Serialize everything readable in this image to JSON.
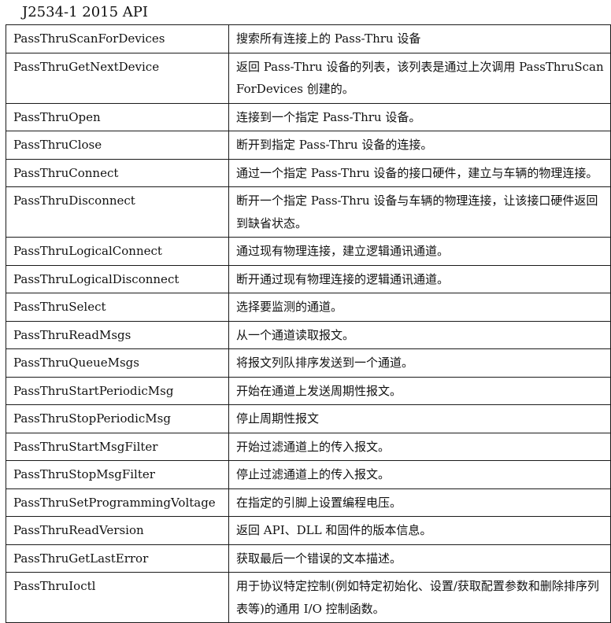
{
  "title": "J2534-1 2015 API",
  "rows": [
    {
      "fn": "PassThruScanForDevices",
      "desc": "搜索所有连接上的 Pass-Thru 设备"
    },
    {
      "fn": "PassThruGetNextDevice",
      "desc": "返回 Pass-Thru 设备的列表，该列表是通过上次调用 PassThruScanForDevices 创建的。"
    },
    {
      "fn": "PassThruOpen",
      "desc": "连接到一个指定 Pass-Thru 设备。"
    },
    {
      "fn": "PassThruClose",
      "desc": "断开到指定 Pass-Thru 设备的连接。"
    },
    {
      "fn": "PassThruConnect",
      "desc": "通过一个指定 Pass-Thru 设备的接口硬件，建立与车辆的物理连接。"
    },
    {
      "fn": "PassThruDisconnect",
      "desc": "断开一个指定 Pass-Thru 设备与车辆的物理连接，让该接口硬件返回到缺省状态。"
    },
    {
      "fn": "PassThruLogicalConnect",
      "desc": "通过现有物理连接，建立逻辑通讯通道。"
    },
    {
      "fn": "PassThruLogicalDisconnect",
      "desc": "断开通过现有物理连接的逻辑通讯通道。"
    },
    {
      "fn": "PassThruSelect",
      "desc": "选择要监测的通道。"
    },
    {
      "fn": "PassThruReadMsgs",
      "desc": "从一个通道读取报文。"
    },
    {
      "fn": "PassThruQueueMsgs",
      "desc": "将报文列队排序发送到一个通道。"
    },
    {
      "fn": "PassThruStartPeriodicMsg",
      "desc": "开始在通道上发送周期性报文。"
    },
    {
      "fn": "PassThruStopPeriodicMsg",
      "desc": "停止周期性报文"
    },
    {
      "fn": "PassThruStartMsgFilter",
      "desc": "开始过滤通道上的传入报文。"
    },
    {
      "fn": "PassThruStopMsgFilter",
      "desc": "停止过滤通道上的传入报文。"
    },
    {
      "fn": "PassThruSetProgrammingVoltage",
      "desc": "在指定的引脚上设置编程电压。"
    },
    {
      "fn": "PassThruReadVersion",
      "desc": "返回 API、DLL 和固件的版本信息。"
    },
    {
      "fn": "PassThruGetLastError",
      "desc": "获取最后一个错误的文本描述。"
    },
    {
      "fn": "PassThruIoctl",
      "desc": "用于协议特定控制(例如特定初始化、设置/获取配置参数和删除排序列表等)的通用 I/O 控制函数。"
    }
  ]
}
